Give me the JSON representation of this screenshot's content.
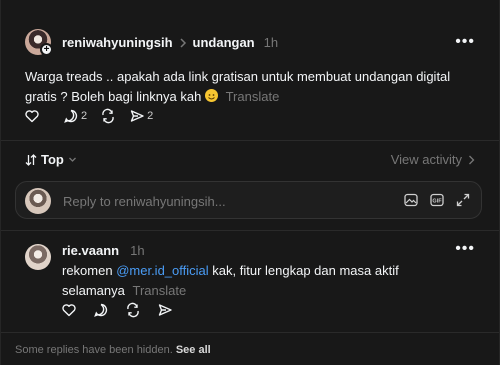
{
  "post": {
    "username": "reniwahyuningsih",
    "topic": "undangan",
    "time": "1h",
    "text": "Warga treads .. apakah ada link gratisan untuk membuat undangan digital gratis ? Boleh bagi linknya kah",
    "emoji": "smiling-face-emoji",
    "translate": "Translate",
    "counts": {
      "replies": "2",
      "shares": "2"
    }
  },
  "sort": {
    "label": "Top",
    "view_activity": "View activity"
  },
  "reply_box": {
    "placeholder": "Reply to reniwahyuningsih..."
  },
  "reply": {
    "username": "rie.vaann",
    "time": "1h",
    "text_before": "rekomen ",
    "mention": "@mer.id_official",
    "text_after": " kak, fitur lengkap dan masa aktif selamanya",
    "translate": "Translate"
  },
  "footer": {
    "text": "Some replies have been hidden.",
    "link": "See all"
  },
  "colors": {
    "background": "#181818",
    "mention": "#4a9cf5",
    "muted": "#777777"
  }
}
